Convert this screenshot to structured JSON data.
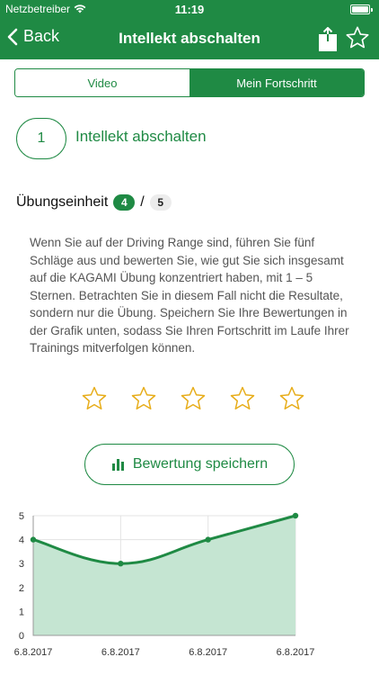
{
  "status_bar": {
    "carrier": "Netzbetreiber",
    "time": "11:19"
  },
  "nav": {
    "back_label": "Back",
    "title": "Intellekt abschalten",
    "icons": [
      "share-icon",
      "star-outline-icon"
    ]
  },
  "tabs": [
    {
      "label": "Video",
      "active": false
    },
    {
      "label": "Mein Fortschritt",
      "active": true
    }
  ],
  "exercise": {
    "number": "1",
    "title": "Intellekt abschalten"
  },
  "unit": {
    "label": "Übungseinheit",
    "current": "4",
    "separator": "/",
    "total": "5"
  },
  "description": "Wenn Sie auf der Driving Range sind, führen Sie fünf Schläge aus und bewerten Sie, wie gut Sie sich insgesamt auf die KAGAMI Übung konzentriert haben, mit 1 – 5 Sternen. Betrachten Sie in diesem Fall nicht die Resultate, sondern nur die Übung. Speichern Sie Ihre Bewertungen in der Grafik unten, sodass Sie Ihren Fortschritt im Laufe Ihrer Trainings mitverfolgen können.",
  "rating": {
    "max": 5,
    "selected": 0
  },
  "save_button": {
    "label": "Bewertung speichern",
    "icon": "bar-chart-icon"
  },
  "colors": {
    "brand_green": "#1f8a44",
    "star_gold": "#e7ad1a",
    "chart_fill": "#c5e5d2"
  },
  "chart_data": {
    "type": "area",
    "categories": [
      "6.8.2017",
      "6.8.2017",
      "6.8.2017",
      "6.8.2017"
    ],
    "values": [
      4,
      3,
      4,
      5
    ],
    "ylim": [
      0,
      5
    ],
    "y_ticks": [
      "0",
      "1",
      "2",
      "3",
      "4",
      "5"
    ],
    "grid": true
  }
}
